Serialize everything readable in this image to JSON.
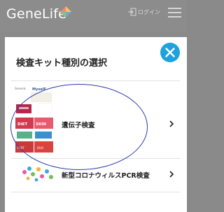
{
  "header": {
    "logo_text": "GeneLife",
    "login_label": "ログイン"
  },
  "modal": {
    "title": "検査キット種別の選択",
    "items": [
      {
        "label": "遺伝子検査"
      },
      {
        "label": "新型コロナウィルスPCR検査"
      }
    ],
    "kit_thumbnail_texts": [
      "Genesis",
      "MyselF",
      "DIET",
      "SKIN",
      "FERTILITY",
      "DUO"
    ]
  },
  "colors": {
    "accent": "#1ea1df",
    "ellipse": "#2f3aa8"
  }
}
